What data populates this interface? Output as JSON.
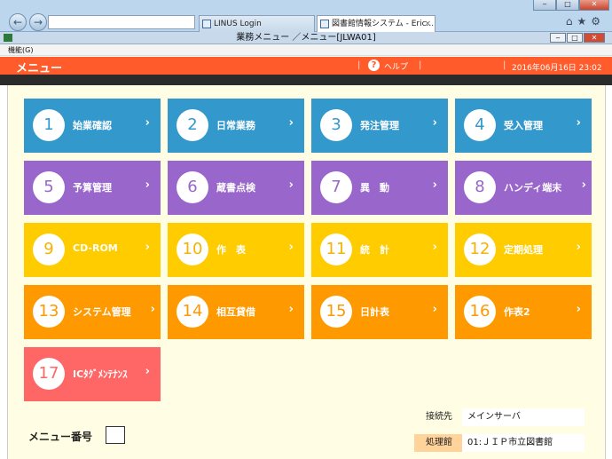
{
  "browser": {
    "tabs": [
      {
        "label": "LINUS Login"
      },
      {
        "label": "図書館情報システム - Eric..."
      }
    ],
    "tab_close": "×",
    "window_controls": {
      "minimize": "‒",
      "maximize": "□",
      "close": "✕"
    }
  },
  "app": {
    "title": "業務メニュー ／メニュー[JLWA01]",
    "menu_item": "機能(G)"
  },
  "header": {
    "title": "メニュー",
    "help_label": "ヘルプ",
    "datetime": "2016年06月16日 23:02"
  },
  "tiles": [
    {
      "num": "1",
      "label": "始業確認",
      "color": "#3399cc"
    },
    {
      "num": "2",
      "label": "日常業務",
      "color": "#3399cc"
    },
    {
      "num": "3",
      "label": "発注管理",
      "color": "#3399cc"
    },
    {
      "num": "4",
      "label": "受入管理",
      "color": "#3399cc"
    },
    {
      "num": "5",
      "label": "予算管理",
      "color": "#9966cc"
    },
    {
      "num": "6",
      "label": "蔵書点検",
      "color": "#9966cc"
    },
    {
      "num": "7",
      "label": "異　動",
      "color": "#9966cc"
    },
    {
      "num": "8",
      "label": "ハンディ端末",
      "color": "#9966cc"
    },
    {
      "num": "9",
      "label": "CD-ROM",
      "color": "#ffcc00"
    },
    {
      "num": "10",
      "label": "作　表",
      "color": "#ffcc00"
    },
    {
      "num": "11",
      "label": "統　計",
      "color": "#ffcc00"
    },
    {
      "num": "12",
      "label": "定期処理",
      "color": "#ffcc00"
    },
    {
      "num": "13",
      "label": "システム管理",
      "color": "#ff9900"
    },
    {
      "num": "14",
      "label": "相互貸借",
      "color": "#ff9900"
    },
    {
      "num": "15",
      "label": "日計表",
      "color": "#ff9900"
    },
    {
      "num": "16",
      "label": "作表2",
      "color": "#ff9900"
    },
    {
      "num": "17",
      "label": "ICﾀｸﾞﾒﾝﾃﾅﾝｽ",
      "color": "#ff6666"
    }
  ],
  "chevron": "›",
  "footer": {
    "menu_number_label": "メニュー番号",
    "menu_number_value": "",
    "connection_label": "接続先",
    "connection_value": "メインサーバ",
    "branch_label": "処理館",
    "branch_value": "01:ＪＩＰ市立図書館"
  },
  "colors": {
    "header": "#ff5b2b",
    "background": "#fffde3"
  }
}
